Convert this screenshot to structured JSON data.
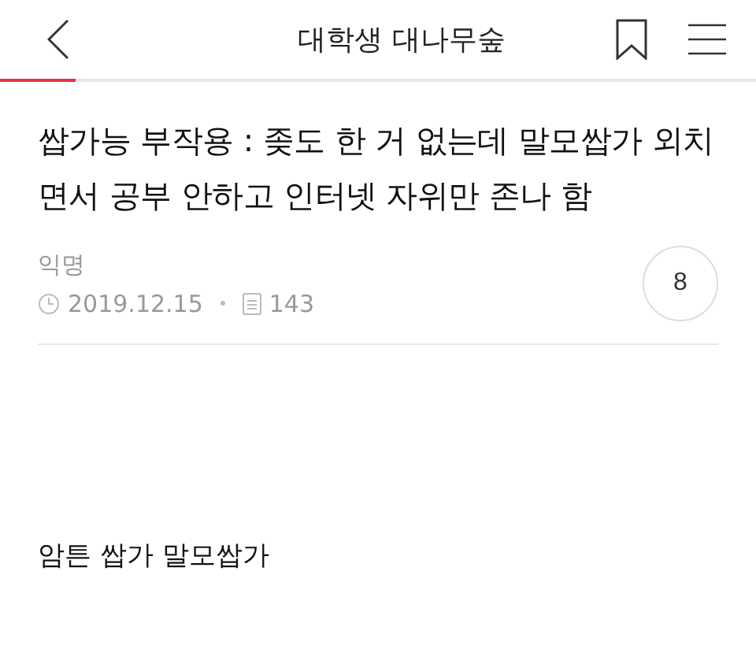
{
  "header": {
    "title": "대학생 대나무숲",
    "progress": {
      "level": 0.1
    }
  },
  "post": {
    "title": "쌉가능 부작용 : 좆도 한 거 없는데 말모쌉가 외치면서 공부 안하고 인터넷 자위만 존나 함",
    "author": "익명",
    "date": "2019.12.15",
    "views": "143",
    "comments": "8",
    "body": "암튼 쌉가 말모쌉가"
  }
}
